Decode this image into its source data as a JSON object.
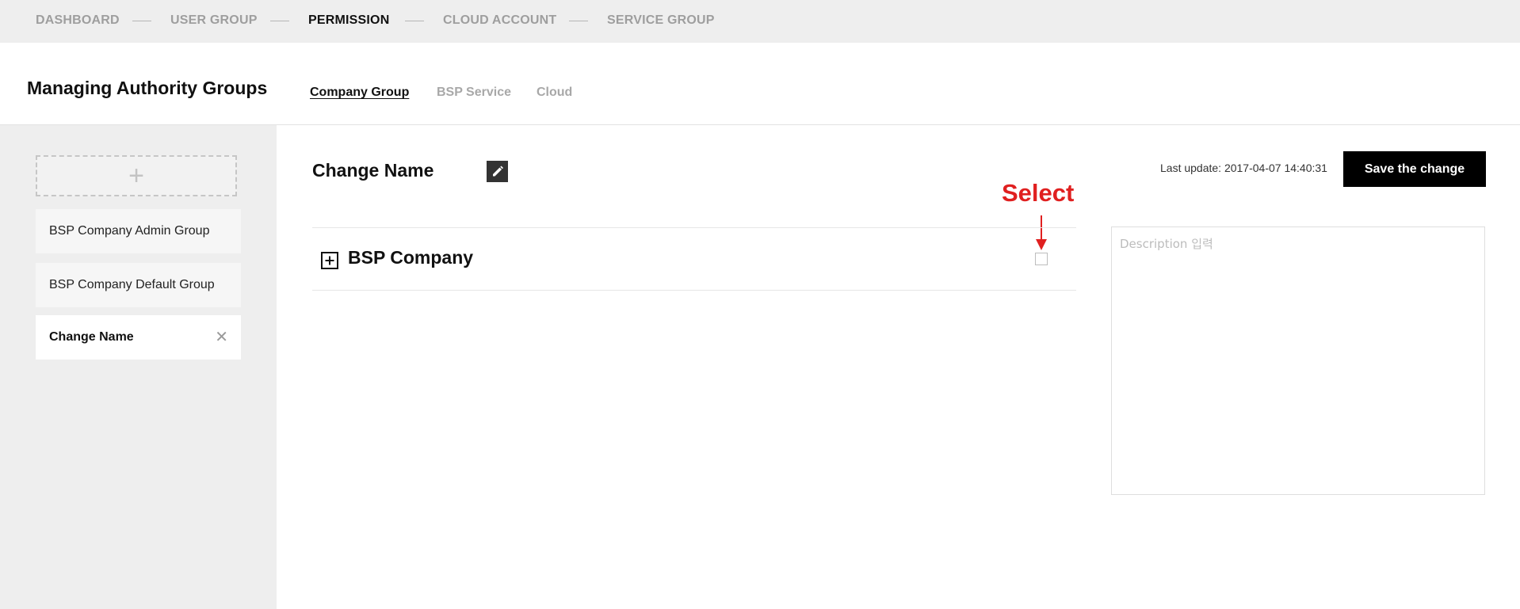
{
  "top_nav": {
    "steps": [
      {
        "label": "DASHBOARD",
        "active": false
      },
      {
        "label": "USER GROUP",
        "active": false
      },
      {
        "label": "PERMISSION",
        "active": true
      },
      {
        "label": "CLOUD ACCOUNT",
        "active": false
      },
      {
        "label": "SERVICE GROUP",
        "active": false
      }
    ]
  },
  "header": {
    "title": "Managing Authority Groups",
    "tabs": [
      {
        "label": "Company Group",
        "active": true
      },
      {
        "label": "BSP Service",
        "active": false
      },
      {
        "label": "Cloud",
        "active": false
      }
    ]
  },
  "sidebar": {
    "add_icon": "plus-icon",
    "groups": [
      {
        "label": "BSP Company Admin Group",
        "selected": false
      },
      {
        "label": "BSP Company Default Group",
        "selected": false
      },
      {
        "label": "Change Name",
        "selected": true,
        "close_icon": "✕"
      }
    ]
  },
  "main": {
    "title": "Change Name",
    "edit_icon": "pencil-icon",
    "last_update": "Last update: 2017-04-07 14:40:31",
    "save_label": "Save the change",
    "tree": [
      {
        "label": "BSP Company",
        "expand_icon": "plus-square-icon",
        "checked": false
      }
    ],
    "annotation": "Select",
    "description_placeholder": "Description 입력",
    "description_value": ""
  },
  "colors": {
    "topnav_bg": "#eeeeee",
    "sidebar_bg": "#eeeeee",
    "primary_button": "#000000",
    "annotation": "#e02020",
    "inactive_text": "#9e9e9e"
  }
}
